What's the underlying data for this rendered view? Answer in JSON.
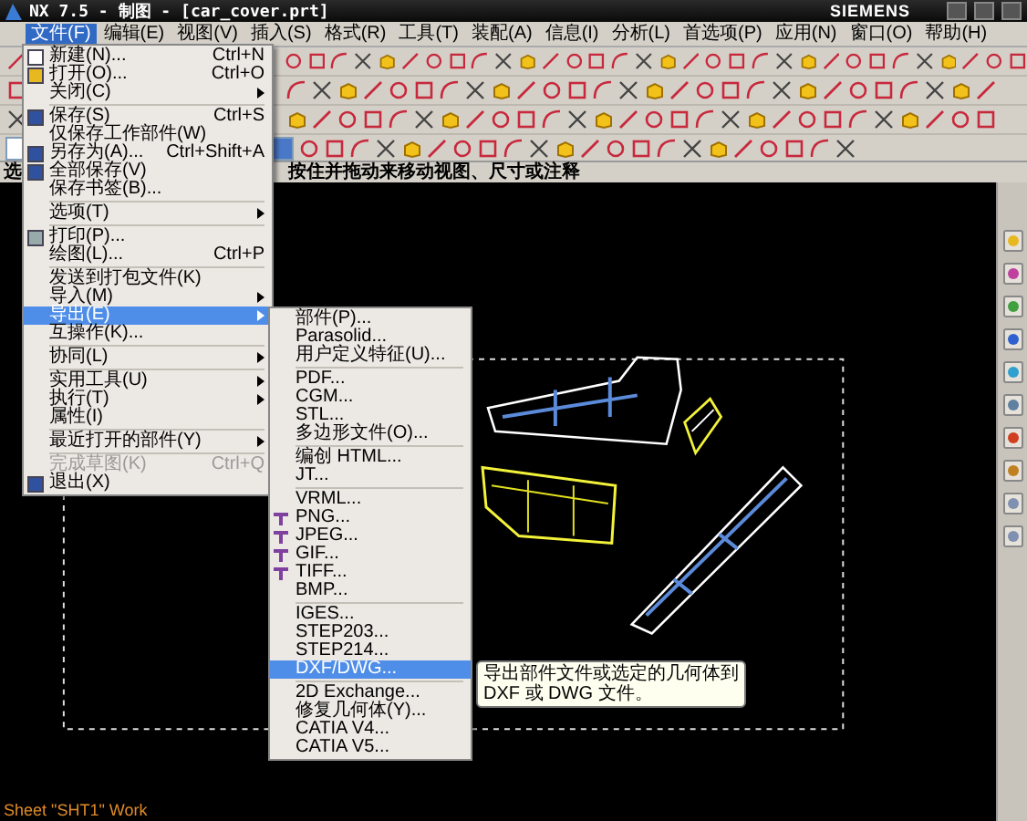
{
  "title_bar": {
    "title": "NX 7.5 - 制图 - [car_cover.prt]",
    "brand": "SIEMENS"
  },
  "menu_bar": [
    {
      "label": "文件(F)",
      "selected": true
    },
    {
      "label": "编辑(E)",
      "selected": false
    },
    {
      "label": "视图(V)",
      "selected": false
    },
    {
      "label": "插入(S)",
      "selected": false
    },
    {
      "label": "格式(R)",
      "selected": false
    },
    {
      "label": "工具(T)",
      "selected": false
    },
    {
      "label": "装配(A)",
      "selected": false
    },
    {
      "label": "信息(I)",
      "selected": false
    },
    {
      "label": "分析(L)",
      "selected": false
    },
    {
      "label": "首选项(P)",
      "selected": false
    },
    {
      "label": "应用(N)",
      "selected": false
    },
    {
      "label": "窗口(O)",
      "selected": false
    },
    {
      "label": "帮助(H)",
      "selected": false
    }
  ],
  "prompt": {
    "left": "选",
    "right": "按住并拖动来移动视图、尺寸或注释"
  },
  "file_menu": [
    {
      "kind": "item",
      "label": "新建(N)...",
      "shortcut": "Ctrl+N",
      "submenu": false,
      "selected": false,
      "disabled": false
    },
    {
      "kind": "item",
      "label": "打开(O)...",
      "shortcut": "Ctrl+O",
      "submenu": false,
      "selected": false,
      "disabled": false
    },
    {
      "kind": "item",
      "label": "关闭(C)",
      "submenu": true,
      "selected": false,
      "disabled": false
    },
    {
      "kind": "separator"
    },
    {
      "kind": "item",
      "label": "保存(S)",
      "shortcut": "Ctrl+S",
      "submenu": false,
      "selected": false,
      "disabled": false
    },
    {
      "kind": "item",
      "label": "仅保存工作部件(W)",
      "submenu": false,
      "selected": false,
      "disabled": false
    },
    {
      "kind": "item",
      "label": "另存为(A)...",
      "shortcut": "Ctrl+Shift+A",
      "submenu": false,
      "selected": false,
      "disabled": false
    },
    {
      "kind": "item",
      "label": "全部保存(V)",
      "submenu": false,
      "selected": false,
      "disabled": false
    },
    {
      "kind": "item",
      "label": "保存书签(B)...",
      "submenu": false,
      "selected": false,
      "disabled": false
    },
    {
      "kind": "separator"
    },
    {
      "kind": "item",
      "label": "选项(T)",
      "submenu": true,
      "selected": false,
      "disabled": false
    },
    {
      "kind": "separator"
    },
    {
      "kind": "item",
      "label": "打印(P)...",
      "submenu": false,
      "selected": false,
      "disabled": false
    },
    {
      "kind": "item",
      "label": "绘图(L)...",
      "shortcut": "Ctrl+P",
      "submenu": false,
      "selected": false,
      "disabled": false
    },
    {
      "kind": "separator"
    },
    {
      "kind": "item",
      "label": "发送到打包文件(K)",
      "submenu": false,
      "selected": false,
      "disabled": false
    },
    {
      "kind": "item",
      "label": "导入(M)",
      "submenu": true,
      "selected": false,
      "disabled": false
    },
    {
      "kind": "item",
      "label": "导出(E)",
      "submenu": true,
      "selected": true,
      "disabled": false
    },
    {
      "kind": "item",
      "label": "互操作(K)...",
      "submenu": false,
      "selected": false,
      "disabled": false
    },
    {
      "kind": "separator"
    },
    {
      "kind": "item",
      "label": "协同(L)",
      "submenu": true,
      "selected": false,
      "disabled": false
    },
    {
      "kind": "separator"
    },
    {
      "kind": "item",
      "label": "实用工具(U)",
      "submenu": true,
      "selected": false,
      "disabled": false
    },
    {
      "kind": "item",
      "label": "执行(T)",
      "submenu": true,
      "selected": false,
      "disabled": false
    },
    {
      "kind": "item",
      "label": "属性(I)",
      "submenu": false,
      "selected": false,
      "disabled": false
    },
    {
      "kind": "separator"
    },
    {
      "kind": "item",
      "label": "最近打开的部件(Y)",
      "submenu": true,
      "selected": false,
      "disabled": false
    },
    {
      "kind": "separator"
    },
    {
      "kind": "item",
      "label": "完成草图(K)",
      "shortcut": "Ctrl+Q",
      "submenu": false,
      "selected": false,
      "disabled": true
    },
    {
      "kind": "item",
      "label": "退出(X)",
      "submenu": false,
      "selected": false,
      "disabled": false
    }
  ],
  "export_menu": [
    {
      "kind": "item",
      "label": "部件(P)...",
      "selected": false
    },
    {
      "kind": "item",
      "label": "Parasolid...",
      "selected": false
    },
    {
      "kind": "item",
      "label": "用户定义特征(U)...",
      "selected": false
    },
    {
      "kind": "separator"
    },
    {
      "kind": "item",
      "label": "PDF...",
      "selected": false
    },
    {
      "kind": "item",
      "label": "CGM...",
      "selected": false
    },
    {
      "kind": "item",
      "label": "STL...",
      "selected": false
    },
    {
      "kind": "item",
      "label": "多边形文件(O)...",
      "selected": false
    },
    {
      "kind": "separator"
    },
    {
      "kind": "item",
      "label": "编创 HTML...",
      "selected": false
    },
    {
      "kind": "item",
      "label": "JT...",
      "selected": false
    },
    {
      "kind": "separator"
    },
    {
      "kind": "item",
      "label": "VRML...",
      "selected": false
    },
    {
      "kind": "item",
      "label": "PNG...",
      "selected": false
    },
    {
      "kind": "item",
      "label": "JPEG...",
      "selected": false
    },
    {
      "kind": "item",
      "label": "GIF...",
      "selected": false
    },
    {
      "kind": "item",
      "label": "TIFF...",
      "selected": false
    },
    {
      "kind": "item",
      "label": "BMP...",
      "selected": false
    },
    {
      "kind": "separator"
    },
    {
      "kind": "item",
      "label": "IGES...",
      "selected": false
    },
    {
      "kind": "item",
      "label": "STEP203...",
      "selected": false
    },
    {
      "kind": "item",
      "label": "STEP214...",
      "selected": false
    },
    {
      "kind": "item",
      "label": "DXF/DWG...",
      "selected": true
    },
    {
      "kind": "separator"
    },
    {
      "kind": "item",
      "label": "2D Exchange...",
      "selected": false
    },
    {
      "kind": "item",
      "label": "修复几何体(Y)...",
      "selected": false
    },
    {
      "kind": "item",
      "label": "CATIA V4...",
      "selected": false
    },
    {
      "kind": "item",
      "label": "CATIA V5...",
      "selected": false
    }
  ],
  "tooltip": "导出部件文件或选定的几何体到 DXF 或 DWG 文件。",
  "status": "Sheet \"SHT1\" Work"
}
